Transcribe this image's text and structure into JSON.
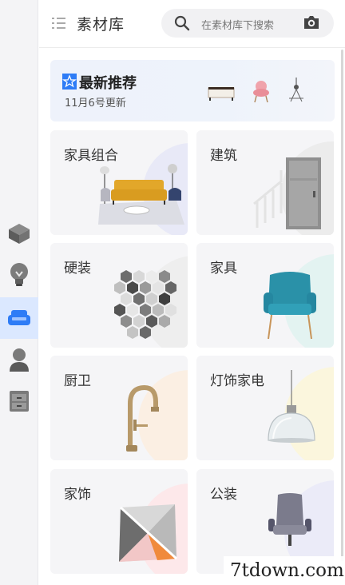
{
  "header": {
    "title": "素材库",
    "search_placeholder": "在素材库下搜索"
  },
  "sidebar": {
    "items": [
      {
        "icon": "cube-icon",
        "active": false
      },
      {
        "icon": "lightbulb-icon",
        "active": false
      },
      {
        "icon": "sofa-icon",
        "active": true
      },
      {
        "icon": "person-icon",
        "active": false
      },
      {
        "icon": "cabinet-icon",
        "active": false
      }
    ]
  },
  "banner": {
    "title": "最新推荐",
    "subtitle": "11月6号更新"
  },
  "categories": [
    {
      "label": "家具组合",
      "accent": "#e8e9f7"
    },
    {
      "label": "建筑",
      "accent": "#ececec"
    },
    {
      "label": "硬装",
      "accent": "#eeeeee"
    },
    {
      "label": "家具",
      "accent": "#e3f3f1"
    },
    {
      "label": "厨卫",
      "accent": "#fbefe3"
    },
    {
      "label": "灯饰家电",
      "accent": "#fbf6dd"
    },
    {
      "label": "家饰",
      "accent": "#fde8ea"
    },
    {
      "label": "公装",
      "accent": "#ebebf8"
    }
  ],
  "watermark": "7tdown.com",
  "colors": {
    "active_rail": "#dbe8ff",
    "brand_blue": "#2e7cf6",
    "card_bg": "#f5f5f7"
  }
}
